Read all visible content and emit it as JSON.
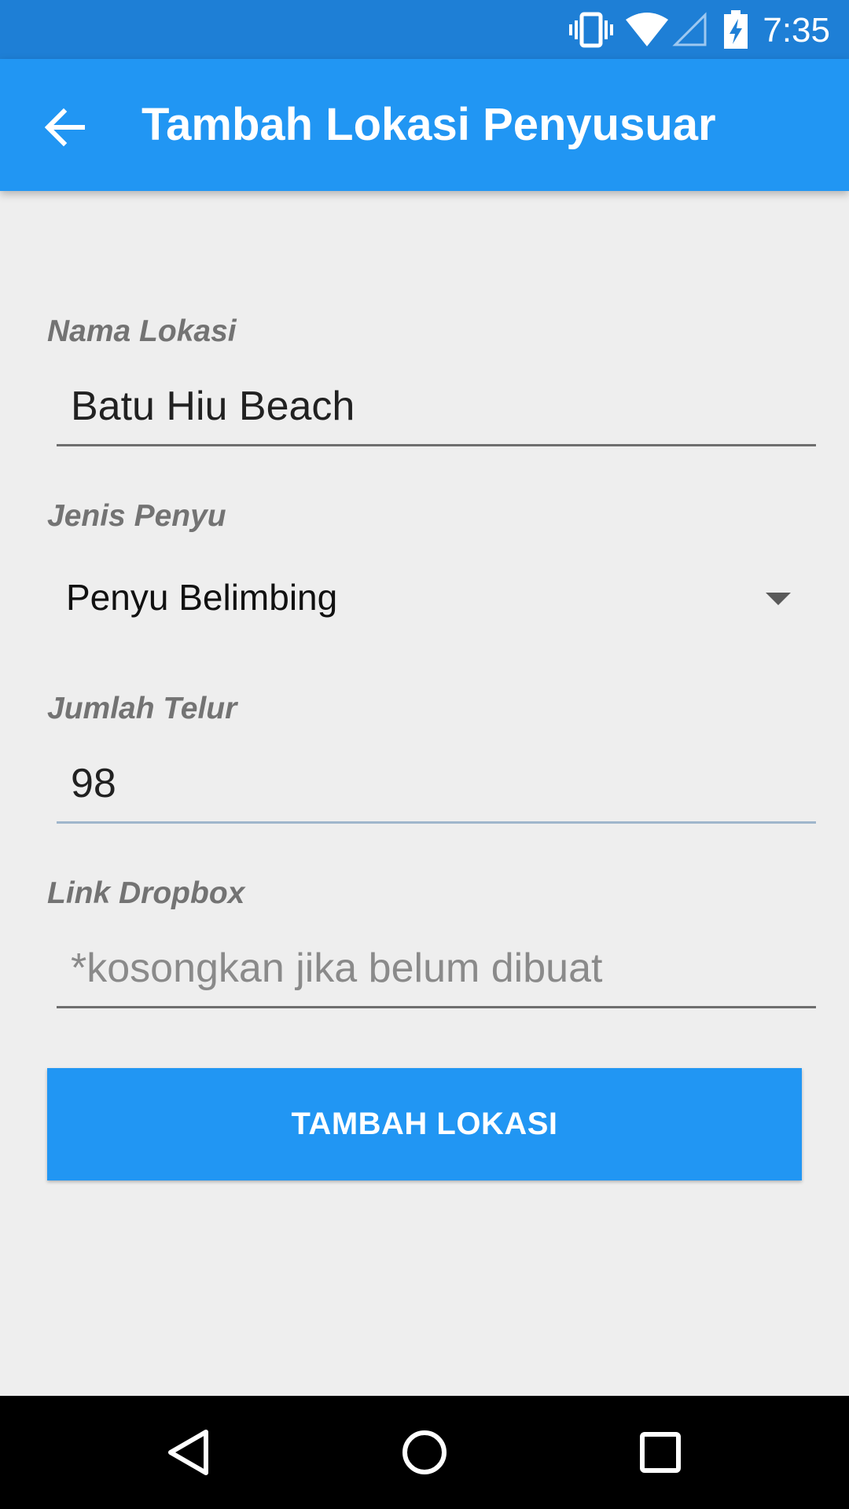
{
  "status_bar": {
    "time": "7:35",
    "icons": [
      "vibrate-icon",
      "wifi-icon",
      "cell-signal-icon",
      "battery-charging-icon"
    ]
  },
  "app_bar": {
    "title": "Tambah Lokasi Penyusuar",
    "back_icon": "arrow-back-icon"
  },
  "form": {
    "nama_lokasi": {
      "label": "Nama Lokasi",
      "value": "Batu Hiu Beach"
    },
    "jenis_penyu": {
      "label": "Jenis Penyu",
      "selected": "Penyu Belimbing"
    },
    "jumlah_telur": {
      "label": "Jumlah Telur",
      "value": "98"
    },
    "link_dropbox": {
      "label": "Link Dropbox",
      "value": "",
      "placeholder": "*kosongkan jika belum dibuat"
    },
    "submit_label": "TAMBAH LOKASI"
  },
  "nav_bar": {
    "icons": [
      "back-triangle-icon",
      "home-circle-icon",
      "recents-square-icon"
    ]
  },
  "colors": {
    "primary": "#2196f3",
    "primary_dark": "#1e7fd6",
    "background": "#eeeeee"
  }
}
